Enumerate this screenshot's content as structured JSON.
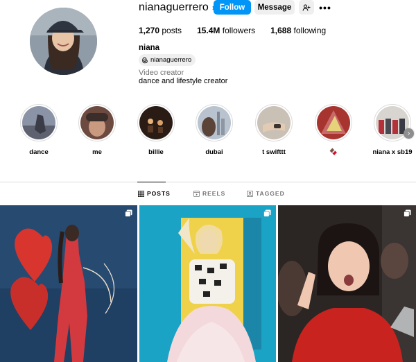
{
  "profile": {
    "username": "nianaguerrero",
    "verified": true,
    "actions": {
      "follow_label": "Follow",
      "message_label": "Message",
      "suggest_icon": "add-person-icon",
      "more_icon": "more-horizontal-icon",
      "more_glyph": "•••"
    },
    "stats": [
      {
        "value": "1,270",
        "label": "posts"
      },
      {
        "value": "15.4M",
        "label": "followers"
      },
      {
        "value": "1,688",
        "label": "following"
      }
    ],
    "full_name": "niana",
    "threads_handle": "nianaguerrero",
    "category": "Video creator",
    "bio": "dance and lifestyle creator"
  },
  "highlights": [
    {
      "label": "dance"
    },
    {
      "label": "me"
    },
    {
      "label": "billie"
    },
    {
      "label": "dubai"
    },
    {
      "label": "t swifttt"
    },
    {
      "label": "🍫"
    },
    {
      "label": "niana x sb19"
    }
  ],
  "tabs": [
    {
      "label": "POSTS",
      "icon": "grid-icon",
      "active": true
    },
    {
      "label": "REELS",
      "icon": "reels-icon",
      "active": false
    },
    {
      "label": "TAGGED",
      "icon": "tagged-icon",
      "active": false
    }
  ],
  "colors": {
    "accent": "#0095f6",
    "secondary_button": "#efefef",
    "muted_text": "#737373",
    "divider": "#dbdbdb"
  },
  "posts": [
    {
      "type": "carousel",
      "icon": "multiple-posts-icon"
    },
    {
      "type": "carousel",
      "icon": "multiple-posts-icon"
    },
    {
      "type": "carousel",
      "icon": "multiple-posts-icon"
    }
  ]
}
